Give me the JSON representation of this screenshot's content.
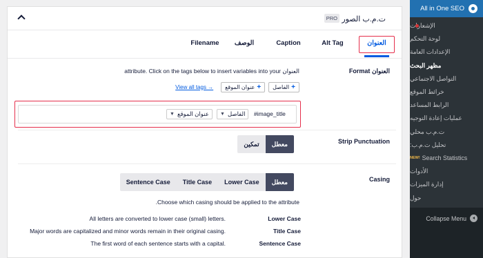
{
  "sidebar": {
    "header_title": "All in One SEO",
    "items": [
      {
        "label": "الإشعارات"
      },
      {
        "label": "لوحة التحكم"
      },
      {
        "label": "الإعدادات العامة"
      },
      {
        "label": "مظهر البحث"
      },
      {
        "label": "التواصل الاجتماعي"
      },
      {
        "label": "خرائط الموقع"
      },
      {
        "label": "الرابط المساعد"
      },
      {
        "label": "عمليات إعادة التوجيه"
      },
      {
        "label": "ت.م.ب محلي"
      },
      {
        "label": "تحليل ت.م.ب:"
      },
      {
        "label": "Search Statistics",
        "badge": "NEW!"
      },
      {
        "label": "الأدوات"
      },
      {
        "label": "إدارة الميزات"
      },
      {
        "label": "حول"
      }
    ],
    "collapse_label": "Collapse Menu",
    "colors": {
      "bg": "#1d2327",
      "header": "#2271b1",
      "notification_dot": "#d63638"
    }
  },
  "panel": {
    "title": "ت.م.ب الصور",
    "pro_badge": "PRO",
    "tabs": [
      {
        "label": "العنوان"
      },
      {
        "label": "Alt Tag"
      },
      {
        "label": "Caption"
      },
      {
        "label": "الوصف"
      },
      {
        "label": "Filename"
      }
    ],
    "active_tab": "العنوان",
    "title_format": {
      "label": "العنوان Format",
      "description": "العنوان attribute. Click on the tags below to insert variables into your",
      "tag_buttons": [
        {
          "label": "الفاصل"
        },
        {
          "label": "عنوان الموقع"
        }
      ],
      "view_all_tags": "View all tags →",
      "input_prefix": "#image_title",
      "chips": [
        {
          "label": "الفاصل"
        },
        {
          "label": "عنوان الموقع"
        }
      ]
    },
    "strip_punctuation": {
      "label": "Strip Punctuation",
      "options": [
        {
          "label": "معطل"
        },
        {
          "label": "تمكين"
        }
      ],
      "selected": "معطل"
    },
    "casing": {
      "label": "Casing",
      "options": [
        {
          "label": "معطل"
        },
        {
          "label": "Lower Case"
        },
        {
          "label": "Title Case"
        },
        {
          "label": "Sentence Case"
        }
      ],
      "selected": "معطل",
      "description": "Choose which casing should be applied to the attribute.",
      "examples": [
        {
          "label": "Lower Case",
          "text": "All letters are converted to lower case (small) letters."
        },
        {
          "label": "Title Case",
          "text": "Major words are capitalized and minor words remain in their original casing."
        },
        {
          "label": "Sentence Case",
          "text": "The first word of each sentence starts with a capital."
        }
      ]
    },
    "colors": {
      "accent": "#005ae0",
      "highlight_outline": "#e52d4a",
      "selected_option": "#434960"
    }
  }
}
